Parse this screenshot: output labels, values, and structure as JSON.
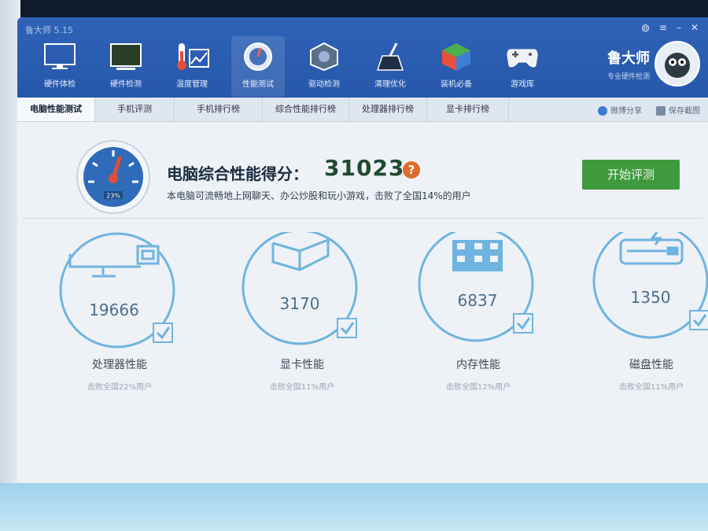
{
  "window": {
    "title": "鲁大师 5.15"
  },
  "nav": [
    {
      "label": "硬件体检",
      "icon": "monitor-icon"
    },
    {
      "label": "硬件检测",
      "icon": "screen-icon"
    },
    {
      "label": "温度管理",
      "icon": "thermometer-icon"
    },
    {
      "label": "性能测试",
      "icon": "speedometer-icon",
      "active": true
    },
    {
      "label": "驱动检测",
      "icon": "driver-gear-icon"
    },
    {
      "label": "清理优化",
      "icon": "broom-icon"
    },
    {
      "label": "装机必备",
      "icon": "cube-icon"
    },
    {
      "label": "游戏库",
      "icon": "gamepad-icon"
    }
  ],
  "brand": {
    "name": "鲁大师",
    "subtitle": "专业硬件检测"
  },
  "tabs": [
    {
      "label": "电脑性能测试",
      "active": true
    },
    {
      "label": "手机评测"
    },
    {
      "label": "手机排行榜"
    },
    {
      "label": "综合性能排行榜"
    },
    {
      "label": "处理器排行榜"
    },
    {
      "label": "显卡排行榜"
    }
  ],
  "share": {
    "weibo": "微博分享",
    "save": "保存截图"
  },
  "score": {
    "title": "电脑综合性能得分：",
    "value": "31023",
    "help": "?",
    "desc": "本电脑可流畅地上网聊天、办公炒股和玩小游戏，击败了全国14%的用户",
    "gauge_label": "23%"
  },
  "start_button": "开始评测",
  "cards": [
    {
      "score": "19666",
      "name": "处理器性能",
      "sub": "击败全国22%用户",
      "icon": "cpu-monitor-icon"
    },
    {
      "score": "3170",
      "name": "显卡性能",
      "sub": "击败全国11%用户",
      "icon": "graphics-cube-icon"
    },
    {
      "score": "6837",
      "name": "内存性能",
      "sub": "击败全国12%用户",
      "icon": "memory-chip-icon"
    },
    {
      "score": "1350",
      "name": "磁盘性能",
      "sub": "击败全国11%用户",
      "icon": "hard-disk-icon"
    }
  ],
  "colors": {
    "accent": "#2f63b8",
    "start": "#3f9a3e",
    "ring": "#6fb4e0",
    "score": "#1f4a2f"
  }
}
